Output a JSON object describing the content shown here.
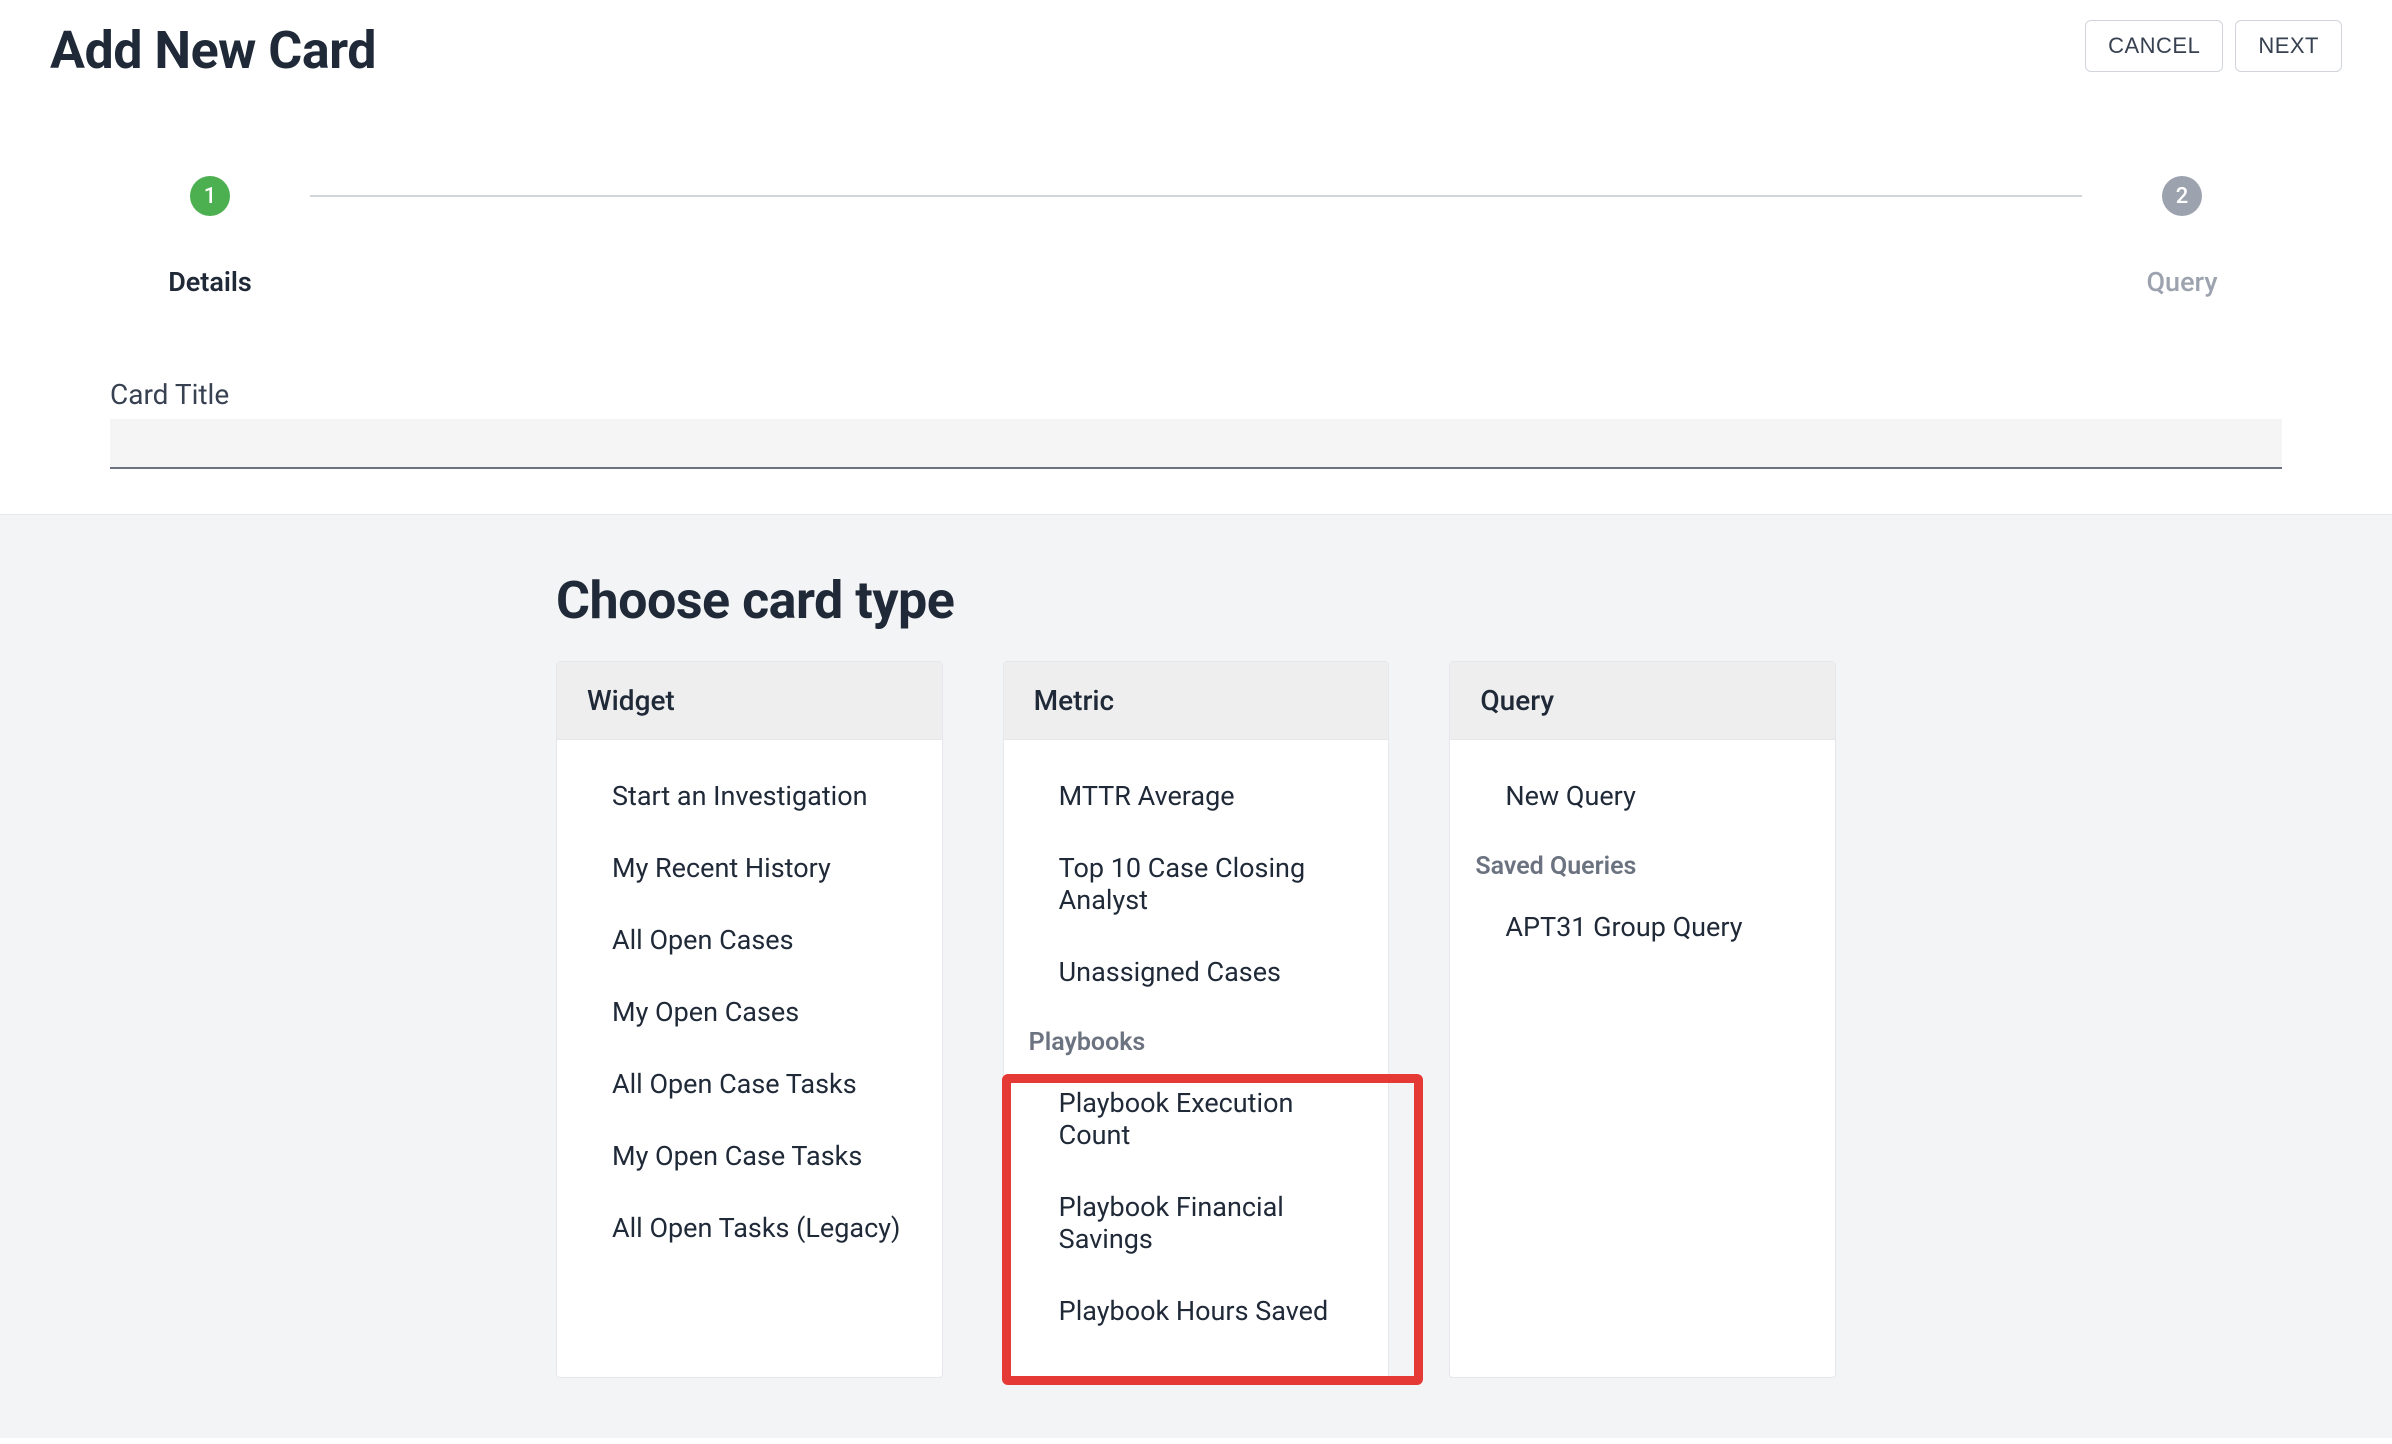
{
  "header": {
    "title": "Add New Card",
    "cancel_label": "CANCEL",
    "next_label": "NEXT"
  },
  "stepper": {
    "steps": [
      {
        "number": "1",
        "label": "Details",
        "active": true
      },
      {
        "number": "2",
        "label": "Query",
        "active": false
      }
    ]
  },
  "form": {
    "card_title_label": "Card Title",
    "card_title_value": ""
  },
  "choose": {
    "heading": "Choose card type",
    "columns": [
      {
        "header": "Widget",
        "items": [
          "Start an Investigation",
          "My Recent History",
          "All Open Cases",
          "My Open Cases",
          "All Open Case Tasks",
          "My Open Case Tasks",
          "All Open Tasks (Legacy)"
        ]
      },
      {
        "header": "Metric",
        "items": [
          "MTTR Average",
          "Top 10 Case Closing Analyst",
          "Unassigned Cases"
        ],
        "subheader": "Playbooks",
        "subitems": [
          "Playbook Execution Count",
          "Playbook Financial Savings",
          "Playbook Hours Saved"
        ]
      },
      {
        "header": "Query",
        "items": [
          "New Query"
        ],
        "subheader": "Saved Queries",
        "subitems": [
          "APT31 Group Query"
        ]
      }
    ]
  }
}
